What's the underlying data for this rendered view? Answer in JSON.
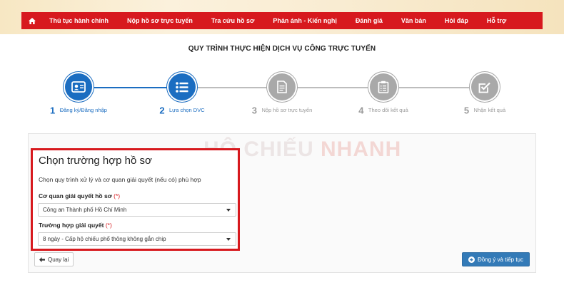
{
  "nav": {
    "home_icon": "home-icon",
    "items": [
      {
        "label": "Thủ tục hành chính"
      },
      {
        "label": "Nộp hồ sơ trực tuyến"
      },
      {
        "label": "Tra cứu hồ sơ"
      },
      {
        "label": "Phản ánh - Kiến nghị"
      },
      {
        "label": "Đánh giá"
      },
      {
        "label": "Văn bản"
      },
      {
        "label": "Hỏi đáp"
      },
      {
        "label": "Hỗ trợ"
      }
    ]
  },
  "page_title": "QUY TRÌNH THỰC HIỆN DỊCH VỤ CÔNG TRỰC TUYẾN",
  "steps": [
    {
      "num": "1",
      "label": "Đăng ký/Đăng nhập",
      "icon": "id-card-icon",
      "state": "active"
    },
    {
      "num": "2",
      "label": "Lựa chọn DVC",
      "icon": "list-icon",
      "state": "active"
    },
    {
      "num": "3",
      "label": "Nộp hồ sơ trực tuyến",
      "icon": "document-icon",
      "state": "inactive"
    },
    {
      "num": "4",
      "label": "Theo dõi kết quả",
      "icon": "clipboard-icon",
      "state": "inactive"
    },
    {
      "num": "5",
      "label": "Nhận kết quả",
      "icon": "check-square-icon",
      "state": "inactive"
    }
  ],
  "watermark": {
    "part1": "HỘ CHIẾU ",
    "part2": "NHANH"
  },
  "form": {
    "title": "Chọn trường hợp hồ sơ",
    "description": "Chọn quy trình xử lý và cơ quan giải quyết (nếu có) phù hợp",
    "agency_label": "Cơ quan giải quyết hồ sơ",
    "agency_required": "(*)",
    "agency_value": "Công an Thành phố Hồ Chí Minh",
    "case_label": "Trường hợp giải quyết",
    "case_required": "(*)",
    "case_value": "8 ngày - Cấp hộ chiếu phổ thông không gắn chip"
  },
  "buttons": {
    "back": "Quay lại",
    "next": "Đồng ý và tiếp tục"
  },
  "colors": {
    "nav_red": "#d7191e",
    "active_blue": "#1b6dc1",
    "inactive_gray": "#a9a9a9",
    "primary_button": "#337ab7"
  }
}
